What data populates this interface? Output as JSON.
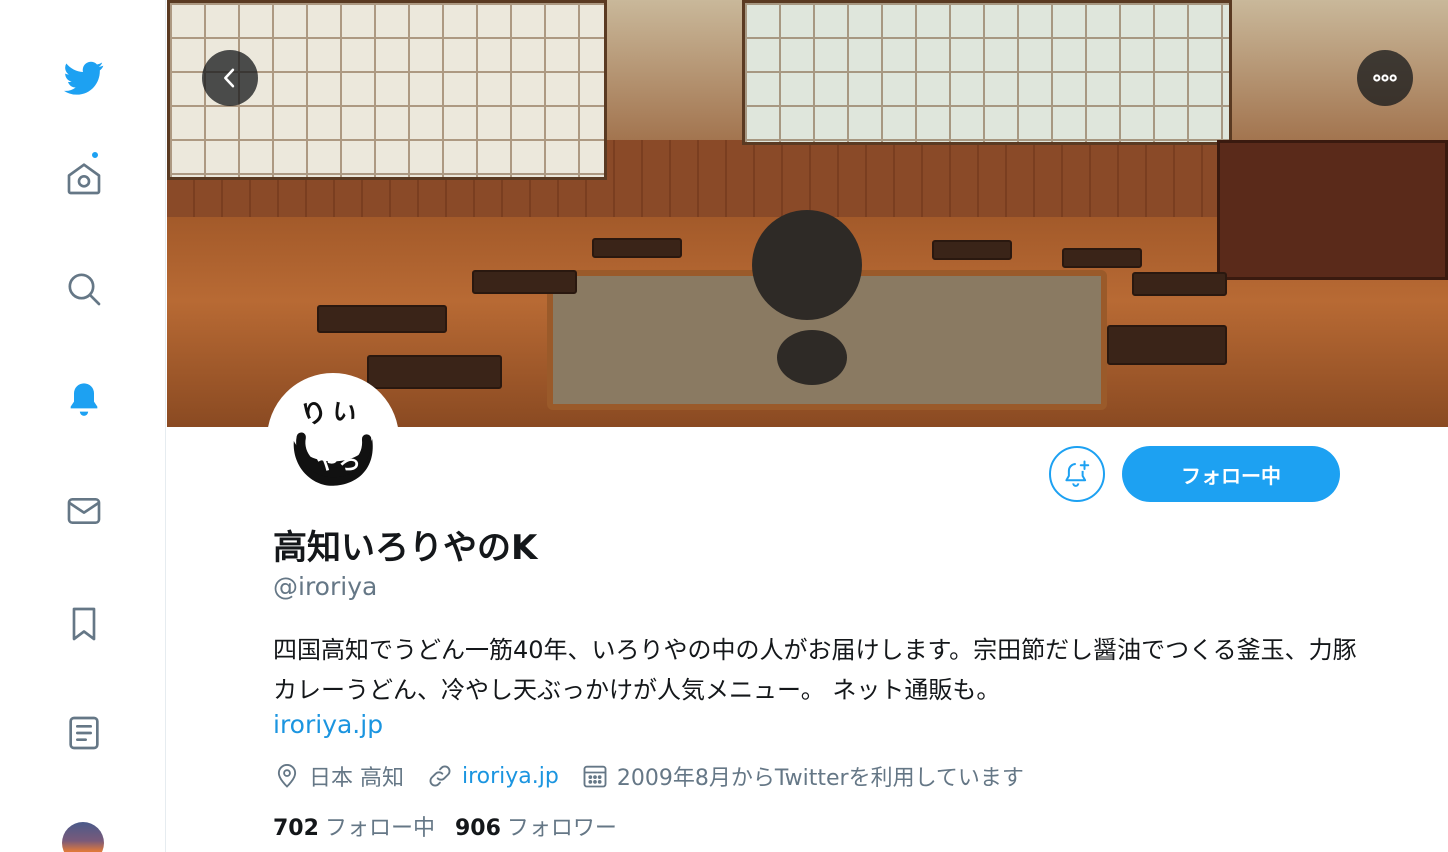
{
  "colors": {
    "accent": "#1da1f2",
    "link": "#1b95e0",
    "muted": "#657786",
    "text": "#14171a"
  },
  "sidebar": {
    "items": [
      {
        "name": "home",
        "icon": "twitter-logo-icon"
      },
      {
        "name": "home-timeline",
        "icon": "home-icon",
        "has_badge": true
      },
      {
        "name": "explore",
        "icon": "search-icon"
      },
      {
        "name": "notifications",
        "icon": "bell-icon",
        "active": true
      },
      {
        "name": "messages",
        "icon": "mail-icon"
      },
      {
        "name": "bookmarks",
        "icon": "bookmark-icon"
      },
      {
        "name": "lists",
        "icon": "list-icon"
      },
      {
        "name": "profile",
        "icon": "avatar"
      }
    ]
  },
  "header": {
    "back_icon": "chevron-left-icon",
    "more_icon": "more-dots-icon"
  },
  "profile": {
    "display_name": "高知いろりやのK",
    "handle": "@iroriya",
    "bio": "四国高知でうどん一筋40年、いろりやの中の人がお届けします。宗田節だし醤油でつくる釜玉、力豚カレーうどん、冷やし天ぶっかけが人気メニュー。 ネット通販も。",
    "bio_link": "iroriya.jp",
    "location": "日本 高知",
    "website": "iroriya.jp",
    "joined": "2009年8月からTwitterを利用しています",
    "following_count": "702",
    "following_label": "フォロー中",
    "followers_count": "906",
    "followers_label": "フォロワー",
    "follow_button_label": "フォロー中",
    "avatar_text": "りいやろ"
  }
}
